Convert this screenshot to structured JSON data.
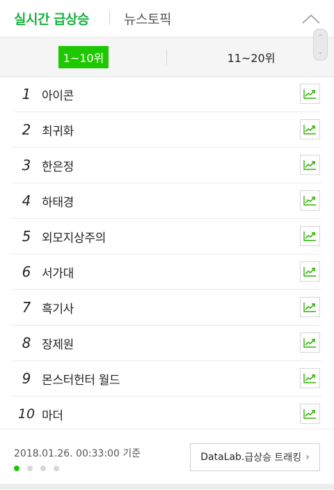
{
  "header": {
    "tab_realtime": "실시간 급상승",
    "tab_news": "뉴스토픽",
    "collapse_icon": "chevron-up-icon"
  },
  "range_tabs": {
    "active": "1~10위",
    "inactive": "11~20위"
  },
  "colors": {
    "accent": "#1ec800",
    "accent_text": "#16b13d",
    "trend_icon": "#2db400"
  },
  "ranking": [
    {
      "rank": "1",
      "keyword": "아이콘"
    },
    {
      "rank": "2",
      "keyword": "최귀화"
    },
    {
      "rank": "3",
      "keyword": "한은정"
    },
    {
      "rank": "4",
      "keyword": "하태경"
    },
    {
      "rank": "5",
      "keyword": "외모지상주의"
    },
    {
      "rank": "6",
      "keyword": "서가대"
    },
    {
      "rank": "7",
      "keyword": "흑기사"
    },
    {
      "rank": "8",
      "keyword": "장제원"
    },
    {
      "rank": "9",
      "keyword": "몬스터헌터 월드"
    },
    {
      "rank": "10",
      "keyword": "마더"
    }
  ],
  "footer": {
    "timestamp": "2018.01.26. 00:33:00 기준",
    "datalab_brand": "DataLab.",
    "datalab_text": "급상승 트래킹",
    "datalab_chevron": "›",
    "page_dots": 4,
    "active_dot": 1
  },
  "scroll": {
    "up_glyph": "⌃",
    "down_glyph": "⌄"
  }
}
